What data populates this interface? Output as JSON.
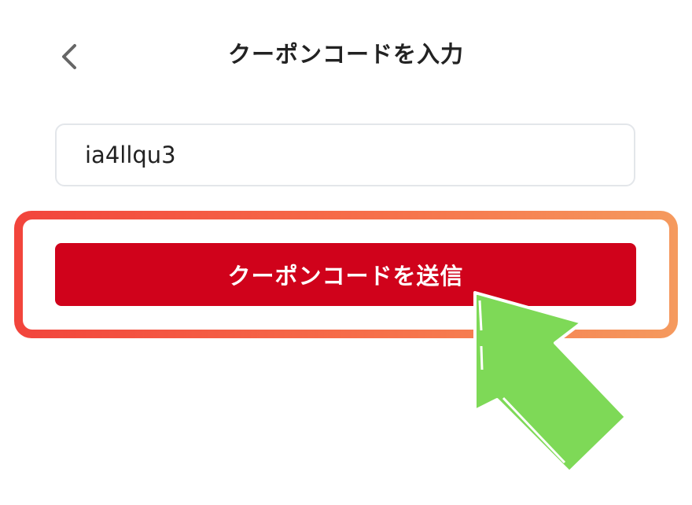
{
  "header": {
    "back_icon": "chevron-left-icon",
    "title": "クーポンコードを入力"
  },
  "coupon_form": {
    "code_value": "ia4llqu3",
    "submit_label": "クーポンコードを送信"
  },
  "annotation": {
    "highlight_color_start": "#f2443c",
    "highlight_color_end": "#f59a5e",
    "arrow_color": "#7ed957",
    "arrow_icon": "pointer-arrow-icon"
  }
}
